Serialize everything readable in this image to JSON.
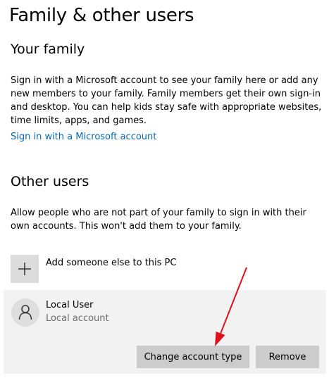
{
  "page": {
    "title": "Family & other users"
  },
  "family": {
    "heading": "Your family",
    "description": "Sign in with a Microsoft account to see your family here or add any new members to your family. Family members get their own sign-in and desktop. You can help kids stay safe with appropriate websites, time limits, apps, and games.",
    "sign_in_link": "Sign in with a Microsoft account"
  },
  "other_users": {
    "heading": "Other users",
    "description": "Allow people who are not part of your family to sign in with their own accounts. This won't add them to your family.",
    "add_label": "Add someone else to this PC",
    "add_icon": "plus-icon",
    "users": [
      {
        "name": "Local User",
        "account_type": "Local account",
        "icon": "person-icon",
        "change_button": "Change account type",
        "remove_button": "Remove"
      }
    ]
  },
  "colors": {
    "link": "#0a66b0",
    "annotation_arrow": "#e0101a",
    "button_bg": "#cccccc",
    "panel_bg": "#f2f2f2"
  }
}
